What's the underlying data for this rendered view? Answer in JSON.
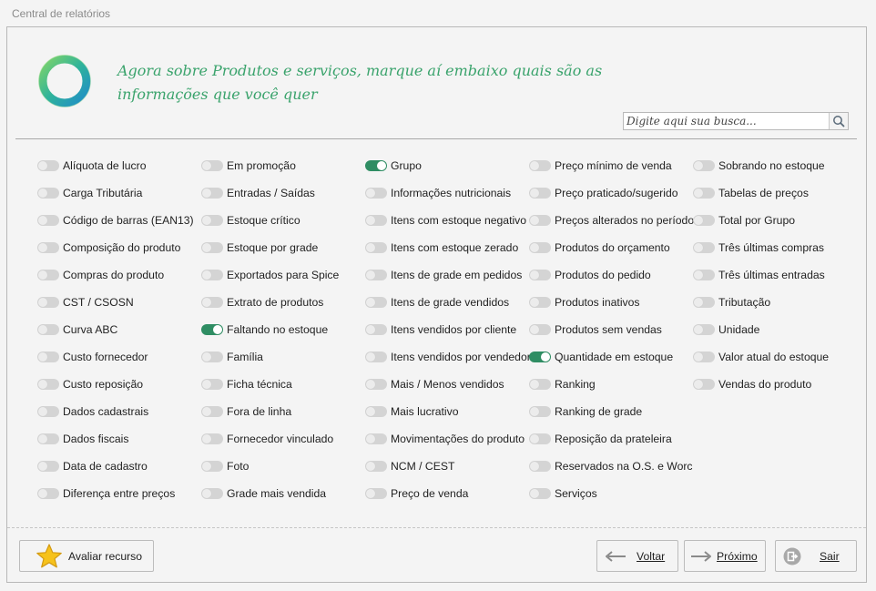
{
  "window": {
    "title": "Central de relatórios"
  },
  "intro": {
    "line1": "Agora sobre Produtos e serviços, marque aí embaixo quais são as",
    "line2": "informações que você quer"
  },
  "search": {
    "placeholder": "Digite aqui sua busca...",
    "value": ""
  },
  "colors": {
    "accent": "#2f8d63",
    "heading": "#3aa36c",
    "toggle_off": "#d4d4d4"
  },
  "columns": [
    [
      {
        "label": "Alíquota de lucro",
        "checked": false
      },
      {
        "label": "Carga Tributária",
        "checked": false
      },
      {
        "label": "Código de barras (EAN13)",
        "checked": false
      },
      {
        "label": "Composição do produto",
        "checked": false
      },
      {
        "label": "Compras do produto",
        "checked": false
      },
      {
        "label": "CST / CSOSN",
        "checked": false
      },
      {
        "label": "Curva ABC",
        "checked": false
      },
      {
        "label": "Custo fornecedor",
        "checked": false
      },
      {
        "label": "Custo reposição",
        "checked": false
      },
      {
        "label": "Dados cadastrais",
        "checked": false
      },
      {
        "label": "Dados fiscais",
        "checked": false
      },
      {
        "label": "Data de cadastro",
        "checked": false
      },
      {
        "label": "Diferença entre preços",
        "checked": false
      }
    ],
    [
      {
        "label": "Em promoção",
        "checked": false
      },
      {
        "label": "Entradas / Saídas",
        "checked": false
      },
      {
        "label": "Estoque crítico",
        "checked": false
      },
      {
        "label": "Estoque por grade",
        "checked": false
      },
      {
        "label": "Exportados para Spice",
        "checked": false
      },
      {
        "label": "Extrato de produtos",
        "checked": false
      },
      {
        "label": "Faltando no estoque",
        "checked": true
      },
      {
        "label": "Família",
        "checked": false
      },
      {
        "label": "Ficha técnica",
        "checked": false
      },
      {
        "label": "Fora de linha",
        "checked": false
      },
      {
        "label": "Fornecedor vinculado",
        "checked": false
      },
      {
        "label": "Foto",
        "checked": false
      },
      {
        "label": "Grade mais vendida",
        "checked": false
      }
    ],
    [
      {
        "label": "Grupo",
        "checked": true
      },
      {
        "label": "Informações nutricionais",
        "checked": false
      },
      {
        "label": "Itens com estoque negativo",
        "checked": false
      },
      {
        "label": "Itens com estoque zerado",
        "checked": false
      },
      {
        "label": "Itens de grade em pedidos",
        "checked": false
      },
      {
        "label": "Itens de grade vendidos",
        "checked": false
      },
      {
        "label": "Itens vendidos por cliente",
        "checked": false
      },
      {
        "label": "Itens vendidos por vendedor",
        "checked": false
      },
      {
        "label": "Mais / Menos vendidos",
        "checked": false
      },
      {
        "label": "Mais lucrativo",
        "checked": false
      },
      {
        "label": "Movimentações do produto",
        "checked": false
      },
      {
        "label": "NCM / CEST",
        "checked": false
      },
      {
        "label": "Preço de venda",
        "checked": false
      }
    ],
    [
      {
        "label": "Preço mínimo de venda",
        "checked": false
      },
      {
        "label": "Preço praticado/sugerido",
        "checked": false
      },
      {
        "label": "Preços alterados no período",
        "checked": false
      },
      {
        "label": "Produtos do orçamento",
        "checked": false
      },
      {
        "label": "Produtos do pedido",
        "checked": false
      },
      {
        "label": "Produtos inativos",
        "checked": false
      },
      {
        "label": "Produtos sem vendas",
        "checked": false
      },
      {
        "label": "Quantidade em estoque",
        "checked": true
      },
      {
        "label": "Ranking",
        "checked": false
      },
      {
        "label": "Ranking de grade",
        "checked": false
      },
      {
        "label": "Reposição da prateleira",
        "checked": false
      },
      {
        "label": "Reservados na O.S. e Worc",
        "checked": false
      },
      {
        "label": "Serviços",
        "checked": false
      }
    ],
    [
      {
        "label": "Sobrando no estoque",
        "checked": false
      },
      {
        "label": "Tabelas de preços",
        "checked": false
      },
      {
        "label": "Total por Grupo",
        "checked": false
      },
      {
        "label": "Três últimas compras",
        "checked": false
      },
      {
        "label": "Três últimas entradas",
        "checked": false
      },
      {
        "label": "Tributação",
        "checked": false
      },
      {
        "label": "Unidade",
        "checked": false
      },
      {
        "label": "Valor atual do estoque",
        "checked": false
      },
      {
        "label": "Vendas do produto",
        "checked": false
      }
    ]
  ],
  "buttons": {
    "rate": {
      "label": "Avaliar recurso",
      "icon": "star-icon"
    },
    "back": {
      "label": "Voltar",
      "icon": "arrow-left-icon"
    },
    "next": {
      "label": "Próximo",
      "icon": "arrow-right-icon"
    },
    "exit": {
      "label": "Sair",
      "icon": "exit-icon"
    }
  }
}
